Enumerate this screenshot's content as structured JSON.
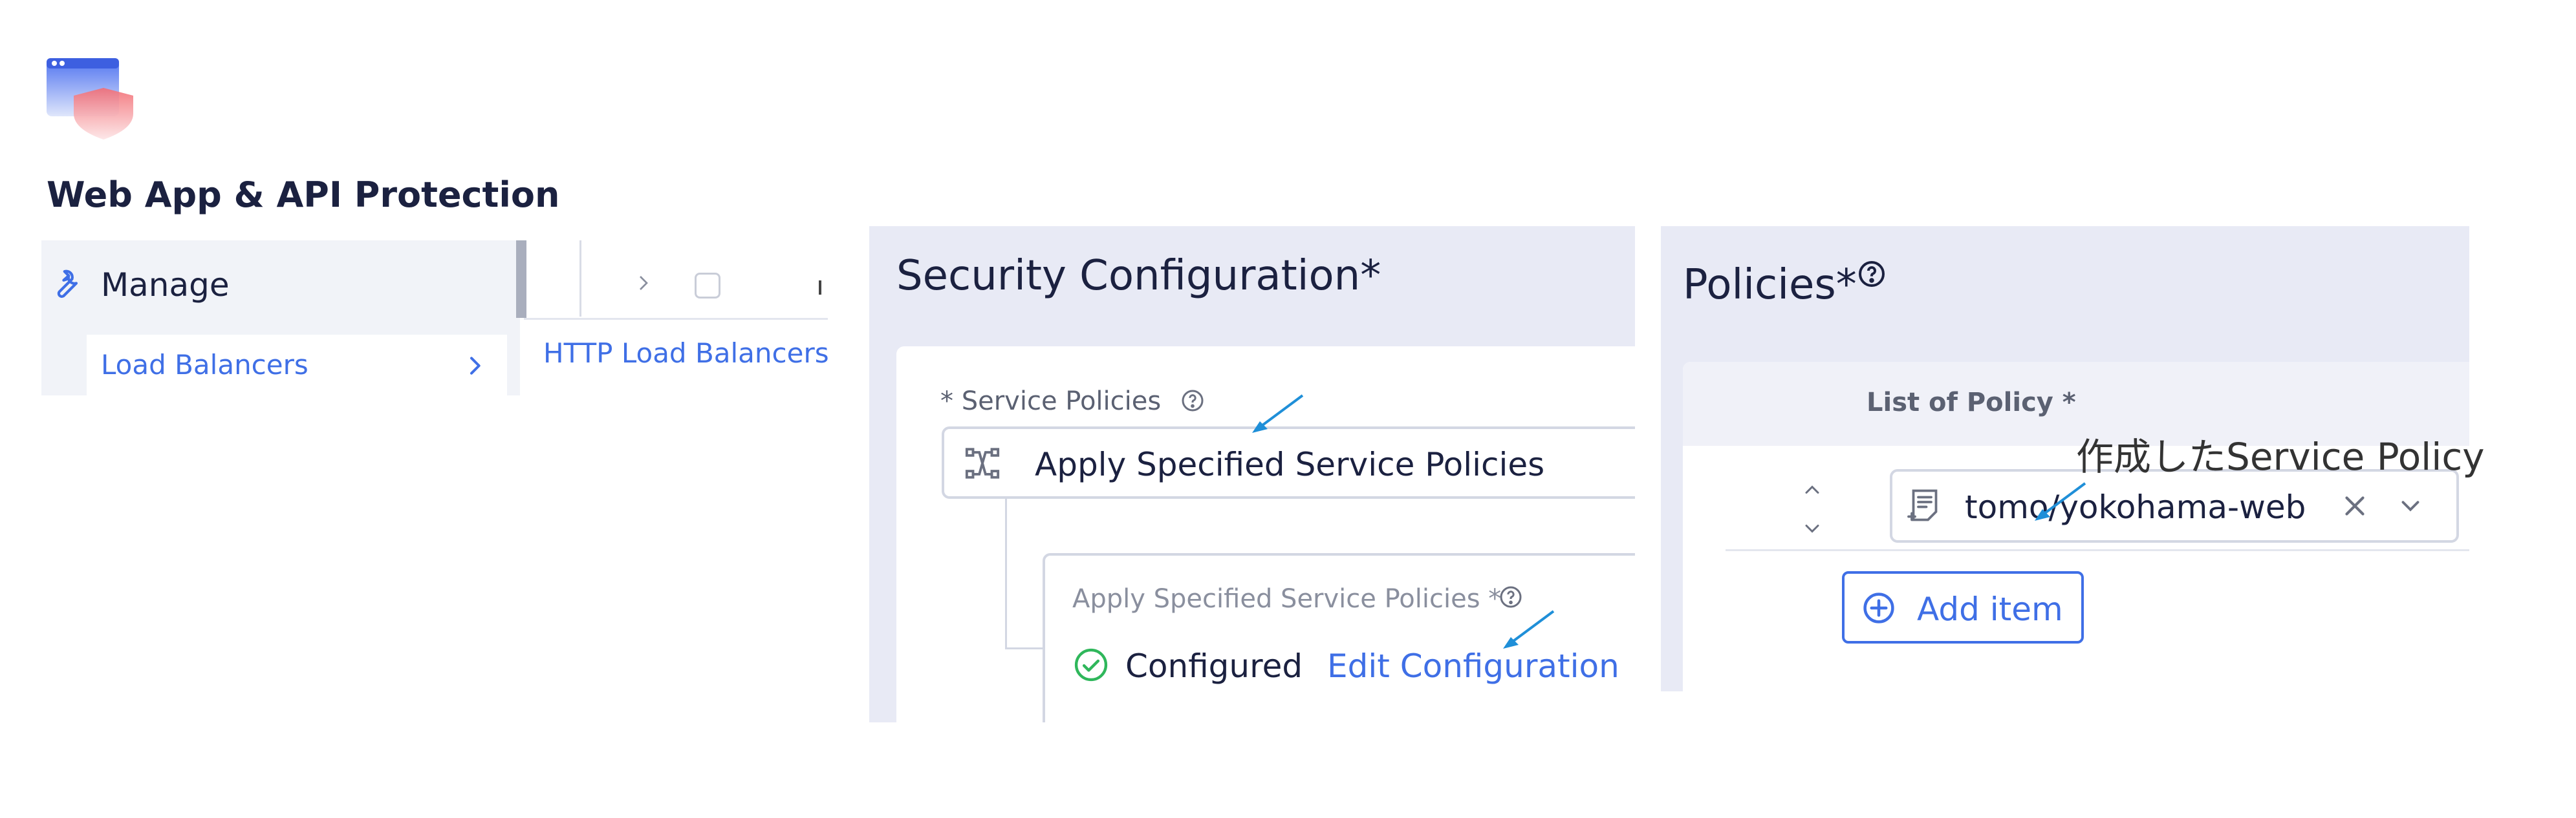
{
  "app": {
    "title": "Web App & API Protection",
    "logo_icon": "browser-shield-icon"
  },
  "nav": {
    "section_label": "Manage",
    "section_icon": "wrench-icon",
    "sub_item_label": "Load Balancers",
    "list_item_label": "HTTP Load Balancers"
  },
  "security": {
    "title": "Security Configuration",
    "title_required": "*",
    "service_policies_label": "* Service Policies",
    "select_value": "Apply Specified Service Policies",
    "sub_label": "Apply Specified Service Policies *",
    "status_label": "Configured",
    "edit_link": "Edit Configuration"
  },
  "policies": {
    "title": "Policies",
    "title_required": "*",
    "list_label": "List of Policy *",
    "policy_value": "tomo/yokohama-web",
    "add_item_label": "Add item"
  },
  "annotation": {
    "text": "作成したService Policy"
  },
  "colors": {
    "accent": "#3f6fe6",
    "panel_bg": "#e8eaf5",
    "success": "#2fb75b",
    "annotation_arrow": "#1f8fd8"
  }
}
